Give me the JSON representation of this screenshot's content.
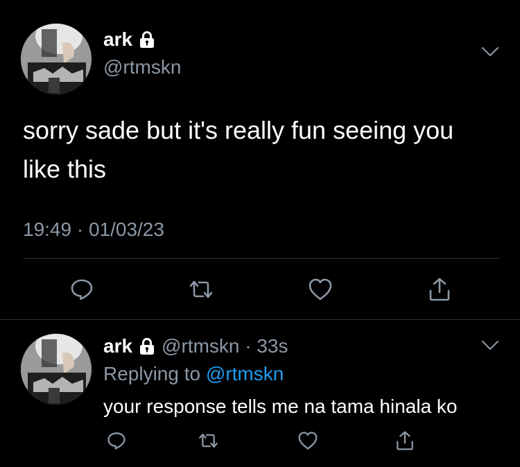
{
  "colors": {
    "background": "#000000",
    "primary_text": "#ffffff",
    "secondary_text": "#8b98a5",
    "accent": "#1d9bf0",
    "divider": "#2f3336"
  },
  "main_tweet": {
    "display_name": "ark",
    "handle": "@rtmskn",
    "text": "sorry sade but it's really fun seeing you like this",
    "timestamp": "19:49 · 01/03/23",
    "icons": [
      "lock-icon",
      "chevron-down-icon",
      "reply-icon",
      "retweet-icon",
      "like-icon",
      "share-icon"
    ]
  },
  "reply_tweet": {
    "display_name": "ark",
    "meta": "@rtmskn · 33s",
    "replying_prefix": "Replying to",
    "replying_handle": "@rtmskn",
    "text": "your response tells me na tama hinala ko",
    "icons": [
      "lock-icon",
      "chevron-down-icon",
      "reply-icon",
      "retweet-icon",
      "like-icon",
      "share-icon"
    ]
  }
}
